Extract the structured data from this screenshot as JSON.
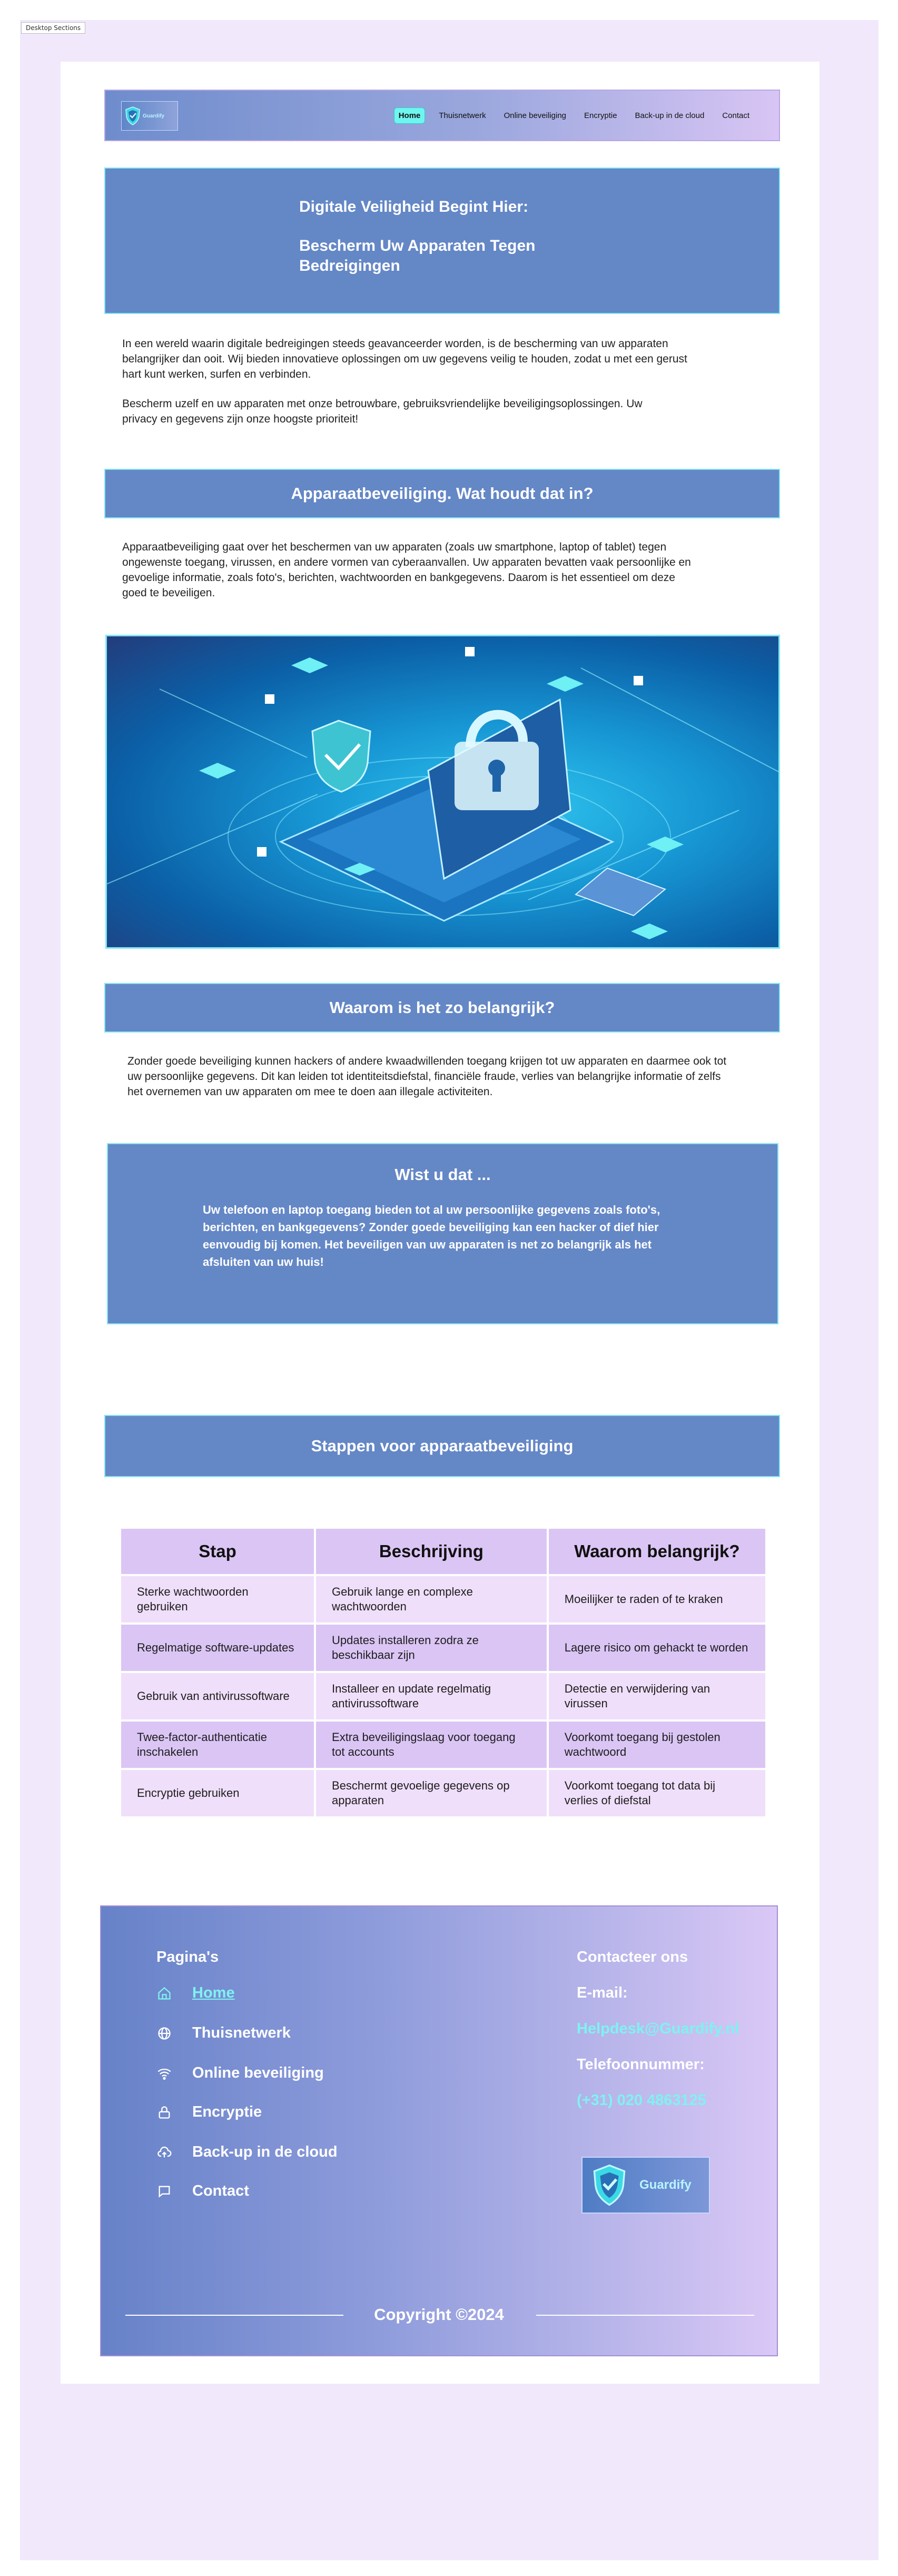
{
  "frame_label": "Desktop Sections",
  "colors": {
    "brand_blue": "#6487c6",
    "cyan_accent": "#7ff2f0",
    "lavender": "#dbc5f5",
    "lavender_light": "#f0dffa",
    "frame_bg": "#f1e8fc"
  },
  "nav": {
    "logo_text": "Guardify",
    "links": [
      "Home",
      "Thuisnetwerk",
      "Online beveiliging",
      "Encryptie",
      "Back-up in de cloud",
      "Contact"
    ],
    "active": "Home"
  },
  "hero": {
    "line1": "Digitale Veiligheid Begint Hier:",
    "line2": "Bescherm Uw Apparaten Tegen Bedreigingen"
  },
  "intro": {
    "p1": "In een wereld waarin digitale bedreigingen steeds geavanceerder worden, is de bescherming van uw apparaten belangrijker dan ooit. Wij bieden innovatieve oplossingen om uw gegevens veilig te houden, zodat u met een gerust hart kunt werken, surfen en verbinden.",
    "p2": "Bescherm uzelf en uw apparaten met onze betrouwbare, gebruiksvriendelijke beveiligingsoplossingen. Uw privacy en gegevens zijn onze hoogste prioriteit!"
  },
  "section1": {
    "title": "Apparaatbeveiliging. Wat houdt dat in?",
    "text": "Apparaatbeveiliging gaat over het beschermen van uw apparaten (zoals uw smartphone, laptop of tablet) tegen ongewenste toegang, virussen, en andere vormen van cyberaanvallen. Uw apparaten bevatten vaak persoonlijke en gevoelige informatie, zoals  foto's, berichten, wachtwoorden en bankgegevens. Daarom is het essentieel om deze goed te beveiligen."
  },
  "hero_image": {
    "icon": "laptop-padlock-illustration"
  },
  "section2": {
    "title": "Waarom is het zo belangrijk?",
    "text": "Zonder goede beveiliging kunnen hackers of andere kwaadwillenden toegang krijgen tot uw apparaten en daarmee ook tot uw persoonlijke gegevens. Dit kan leiden tot identiteitsdiefstal, financiële fraude, verlies van belangrijke informatie of zelfs het overnemen van uw apparaten om mee te doen aan illegale activiteiten."
  },
  "did_you_know": {
    "title": "Wist u dat ...",
    "text": "Uw telefoon en laptop toegang bieden tot al uw persoonlijke gegevens zoals foto's, berichten, en bankgegevens? Zonder goede beveiliging kan een hacker of dief hier eenvoudig bij komen. Het beveiligen van uw apparaten is net zo belangrijk als het afsluiten van uw huis!"
  },
  "steps": {
    "title": "Stappen voor apparaatbeveiliging",
    "headers": [
      "Stap",
      "Beschrijving",
      "Waarom belangrijk?"
    ],
    "rows": [
      [
        "Sterke wachtwoorden gebruiken",
        "Gebruik lange en complexe wachtwoorden",
        "Moeilijker te raden of te kraken"
      ],
      [
        "Regelmatige software-updates",
        "Updates installeren zodra ze beschikbaar zijn",
        "Lagere risico om gehackt te worden"
      ],
      [
        "Gebruik van antivirussoftware",
        "Installeer en update regelmatig antivirussoftware",
        "Detectie en verwijdering van virussen"
      ],
      [
        "Twee-factor-authenticatie inschakelen",
        "Extra beveiligingslaag voor toegang tot accounts",
        "Voorkomt toegang bij gestolen wachtwoord"
      ],
      [
        "Encryptie gebruiken",
        "Beschermt gevoelige gegevens op apparaten",
        "Voorkomt toegang tot data bij verlies of diefstal"
      ]
    ]
  },
  "footer": {
    "pages_heading": "Pagina's",
    "pages": [
      {
        "label": "Home",
        "icon": "home-icon"
      },
      {
        "label": "Thuisnetwerk",
        "icon": "globe-icon"
      },
      {
        "label": "Online beveiliging",
        "icon": "wifi-icon"
      },
      {
        "label": "Encryptie",
        "icon": "lock-icon"
      },
      {
        "label": "Back-up in de cloud",
        "icon": "cloud-upload-icon"
      },
      {
        "label": "Contact",
        "icon": "chat-icon"
      }
    ],
    "contact_heading": "Contacteer ons",
    "email_label": "E-mail:",
    "email_value": "Helpdesk@Guardify.nl",
    "phone_label": "Telefoonnummer:",
    "phone_value": "(+31) 020 4863125",
    "logo_text": "Guardify",
    "copyright": "Copyright ©2024"
  }
}
